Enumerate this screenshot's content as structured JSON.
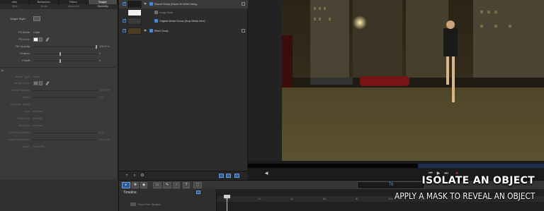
{
  "inspector": {
    "tabs": [
      "rties",
      "Behaviors",
      "Filters",
      "Shape"
    ],
    "active_tab": "Shape",
    "subtabs": [
      "Style",
      "Stroke",
      "Advanced",
      "Geometry"
    ],
    "active_subtab": "Geometry",
    "shape_style_label": "Shape Style:",
    "fill_rows": [
      {
        "label": "Fill Mode:",
        "value": "Color"
      },
      {
        "label": "Fill Color:"
      },
      {
        "label": "Fill Opacity:",
        "value": "100.0 %",
        "level_percent": 100
      },
      {
        "label": "Feather:",
        "value": "0",
        "level_percent": 42
      },
      {
        "label": "Falloff:",
        "value": "0",
        "level_percent": 42
      }
    ],
    "section_stroke": "e",
    "stroke_rows": [
      {
        "label": "Brush Type:",
        "value": "Solid"
      },
      {
        "label": "Brush Color:"
      },
      {
        "label": "Brush Opacity:",
        "value": "100.0 %"
      },
      {
        "label": "Width:",
        "value": "2.0"
      },
      {
        "label": "Pressure Width:",
        "value": ""
      },
      {
        "label": "Joint:",
        "value": "Round"
      },
      {
        "label": "Start Cap:",
        "value": "Round"
      },
      {
        "label": "End Cap:",
        "value": "Round"
      },
      {
        "label": "First Point Offset:",
        "value": "0 %"
      },
      {
        "label": "Last Point Offset:",
        "value": "100.0 %"
      },
      {
        "label": "Order:",
        "value": "Over Fill"
      }
    ]
  },
  "layers": [
    {
      "name": "Source Group (Chuck On When Using...",
      "checked": true
    },
    {
      "name": "Image Mask",
      "checked": false
    },
    {
      "name": "Original Media Source (Drop Media Here)",
      "checked": true
    },
    {
      "name": "Effect Group",
      "checked": true
    }
  ],
  "timecode": "70",
  "timeline": {
    "title": "Timeline",
    "track_name": "Pixel Film Studios",
    "ruler_ticks": [
      "01",
      "21",
      "41",
      "61",
      "81",
      "101",
      "121",
      "141",
      "161",
      "181"
    ]
  },
  "caption": {
    "title": "ISOLATE AN OBJECT",
    "subtitle": "APPLY A MASK TO REVEAL AN OBJECT"
  },
  "colors": {
    "accent": "#2e5a9b",
    "panel": "#3a3a3a"
  }
}
